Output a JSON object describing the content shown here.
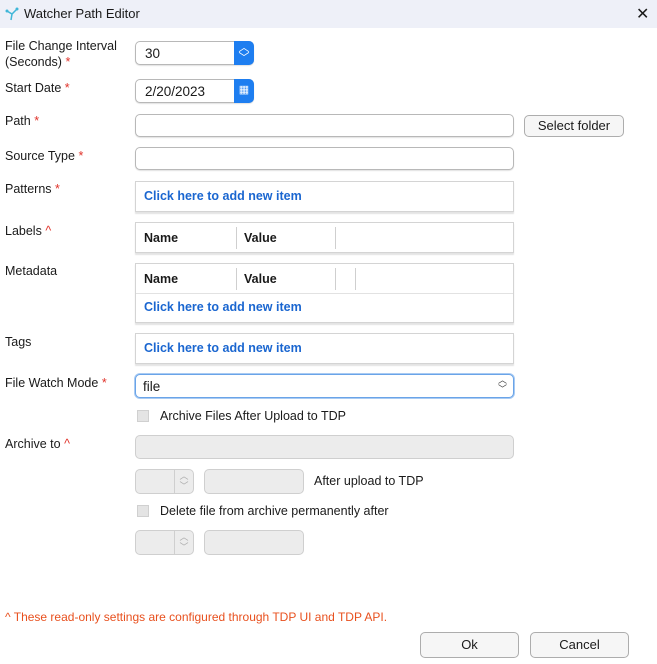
{
  "window": {
    "title": "Watcher Path Editor"
  },
  "fields": {
    "interval_label": "File Change Interval",
    "interval_label2": "(Seconds)",
    "interval_value": "30",
    "start_date_label": "Start Date",
    "start_date_value": "2/20/2023",
    "path_label": "Path",
    "path_value": "",
    "select_folder": "Select folder",
    "source_type_label": "Source Type",
    "source_type_value": "",
    "patterns_label": "Patterns",
    "add_item": "Click here to add new item",
    "labels_label": "Labels",
    "metadata_label": "Metadata",
    "tags_label": "Tags",
    "col_name": "Name",
    "col_value": "Value",
    "watch_mode_label": "File Watch Mode",
    "watch_mode_value": "file",
    "archive_checkbox": "Archive Files After Upload to TDP",
    "archive_to_label": "Archive to",
    "after_upload": "After upload to TDP",
    "delete_checkbox": "Delete file from archive permanently after",
    "required_mark": "*",
    "readonly_mark": "^"
  },
  "footer": {
    "note": "^ These read-only settings are configured through TDP UI and TDP API.",
    "ok": "Ok",
    "cancel": "Cancel"
  }
}
